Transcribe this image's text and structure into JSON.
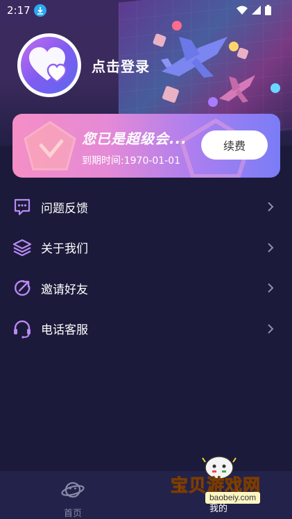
{
  "status_bar": {
    "time": "2:17"
  },
  "profile": {
    "login_prompt": "点击登录"
  },
  "vip_card": {
    "title": "您已是超级会...",
    "expire_label": "到期时间:1970-01-01",
    "renew_label": "续费"
  },
  "menu": {
    "items": [
      {
        "label": "问题反馈",
        "icon": "message-icon"
      },
      {
        "label": "关于我们",
        "icon": "layers-icon"
      },
      {
        "label": "邀请好友",
        "icon": "share-icon"
      },
      {
        "label": "电话客服",
        "icon": "headset-icon"
      }
    ]
  },
  "bottom_nav": {
    "home_label": "首页",
    "mine_label": "我的"
  },
  "watermark": {
    "title": "宝贝游戏网",
    "url": "baobeiy.com"
  },
  "colors": {
    "background": "#1b1a3a",
    "accent": "#b57ef0",
    "nav_bg": "#23224a"
  }
}
